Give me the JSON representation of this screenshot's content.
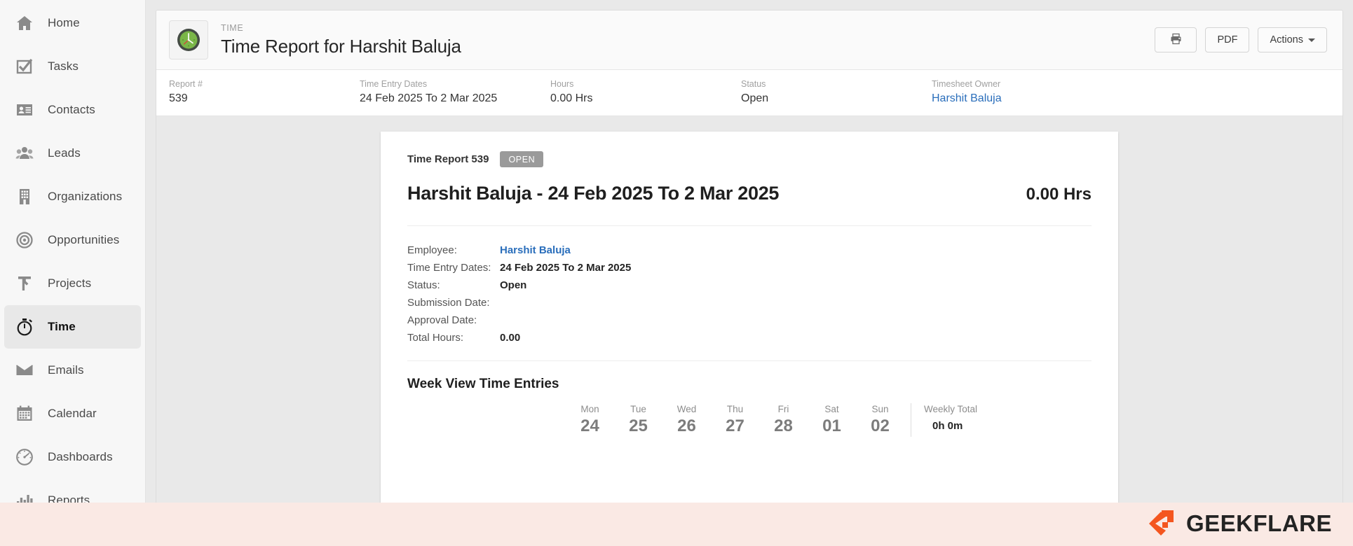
{
  "sidebar": {
    "items": [
      {
        "label": "Home",
        "icon": "home-icon",
        "active": false
      },
      {
        "label": "Tasks",
        "icon": "checkbox-icon",
        "active": false
      },
      {
        "label": "Contacts",
        "icon": "contact-card-icon",
        "active": false
      },
      {
        "label": "Leads",
        "icon": "people-icon",
        "active": false
      },
      {
        "label": "Organizations",
        "icon": "building-icon",
        "active": false
      },
      {
        "label": "Opportunities",
        "icon": "target-icon",
        "active": false
      },
      {
        "label": "Projects",
        "icon": "hammer-icon",
        "active": false
      },
      {
        "label": "Time",
        "icon": "stopwatch-icon",
        "active": true
      },
      {
        "label": "Emails",
        "icon": "envelope-icon",
        "active": false
      },
      {
        "label": "Calendar",
        "icon": "calendar-icon",
        "active": false
      },
      {
        "label": "Dashboards",
        "icon": "gauge-icon",
        "active": false
      },
      {
        "label": "Reports",
        "icon": "bar-chart-icon",
        "active": false
      }
    ]
  },
  "header": {
    "eyebrow": "TIME",
    "title": "Time Report for Harshit Baluja",
    "module_icon": "green-clock-icon",
    "actions": {
      "print_icon": "printer-icon",
      "pdf_label": "PDF",
      "actions_label": "Actions",
      "caret_icon": "chevron-down-icon"
    }
  },
  "meta": {
    "fields": [
      {
        "label": "Report #",
        "value": "539",
        "link": false
      },
      {
        "label": "Time Entry Dates",
        "value": "24 Feb 2025 To 2 Mar 2025",
        "link": false
      },
      {
        "label": "Hours",
        "value": "0.00 Hrs",
        "link": false
      },
      {
        "label": "Status",
        "value": "Open",
        "link": false
      },
      {
        "label": "Timesheet Owner",
        "value": "Harshit Baluja",
        "link": true
      }
    ]
  },
  "document": {
    "report_no": "Time Report 539",
    "status_badge": "OPEN",
    "headline": "Harshit Baluja - 24 Feb 2025 To 2 Mar 2025",
    "hours": "0.00 Hrs",
    "details": [
      {
        "label": "Employee:",
        "value": "Harshit Baluja",
        "link": true
      },
      {
        "label": "Time Entry Dates:",
        "value": "24 Feb 2025 To 2 Mar 2025",
        "link": false
      },
      {
        "label": "Status:",
        "value": "Open",
        "link": false
      },
      {
        "label": "Submission Date:",
        "value": "",
        "link": false
      },
      {
        "label": "Approval Date:",
        "value": "",
        "link": false
      },
      {
        "label": "Total Hours:",
        "value": "0.00",
        "link": false
      }
    ],
    "week_section_title": "Week View Time Entries",
    "week": {
      "days": [
        {
          "name": "Mon",
          "num": "24"
        },
        {
          "name": "Tue",
          "num": "25"
        },
        {
          "name": "Wed",
          "num": "26"
        },
        {
          "name": "Thu",
          "num": "27"
        },
        {
          "name": "Fri",
          "num": "28"
        },
        {
          "name": "Sat",
          "num": "01"
        },
        {
          "name": "Sun",
          "num": "02"
        }
      ],
      "total_label": "Weekly Total",
      "total_value": "0h 0m"
    }
  },
  "watermark": {
    "text": "GEEKFLARE",
    "logo_icon": "geekflare-logo-icon",
    "accent_color": "#f4561f",
    "band_color": "#fae9e4"
  }
}
